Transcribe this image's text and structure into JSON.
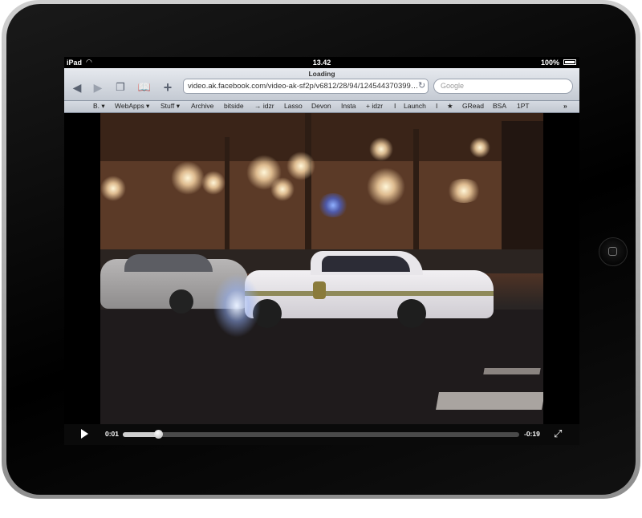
{
  "status_bar": {
    "carrier": "iPad",
    "time": "13.42",
    "battery": "100%"
  },
  "toolbar": {
    "title": "Loading",
    "url": "video.ak.facebook.com/video-ak-sf2p/v6812/28/94/124544370399…",
    "search_placeholder": "Google"
  },
  "bookmarks": [
    "B. ▾",
    "WebApps ▾",
    "Stuff ▾",
    "Archive",
    "bitside",
    "→ idzr",
    "Lasso",
    "Devon",
    "Insta",
    "+ idzr",
    "I",
    "Launch",
    "I",
    "★",
    "GRead",
    "BSA",
    "1PT"
  ],
  "video": {
    "elapsed": "0:01",
    "remaining": "-0:19",
    "progress": 0.09
  },
  "icons": {
    "back": "back-arrow-icon",
    "forward": "forward-arrow-icon",
    "pages": "pages-icon",
    "bookmarks": "bookmarks-book-icon",
    "add": "add-plus-icon",
    "reload": "reload-icon",
    "apple": "apple-logo-icon",
    "overflow": "chevron-double-right-icon",
    "play": "play-icon",
    "fullscreen": "fullscreen-icon"
  }
}
